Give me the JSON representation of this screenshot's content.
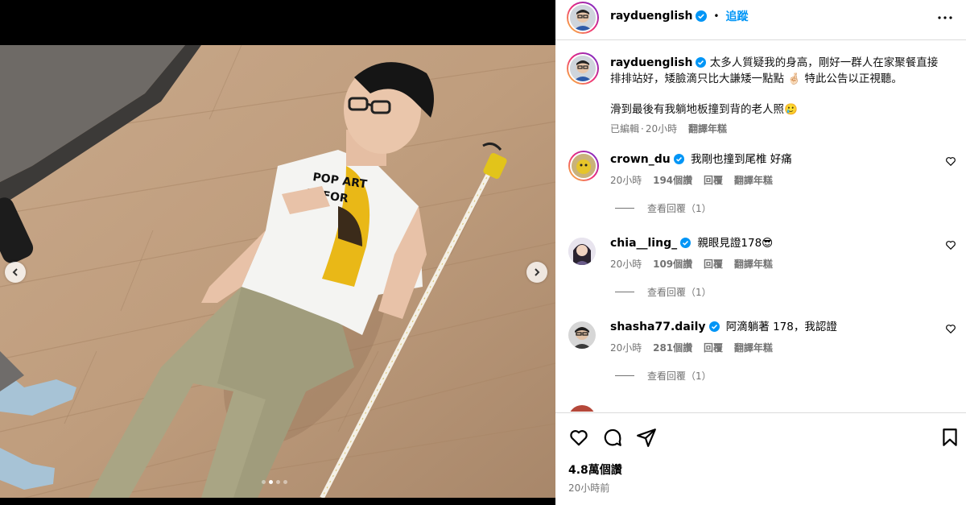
{
  "post": {
    "username": "rayduenglish",
    "follow_label": "追蹤",
    "separator": "•",
    "caption_line1": "太多人質疑我的身高，剛好一群人在家聚餐直接",
    "caption_line2": "排排站好，矮臉滴只比大謙矮一點點 🤞🏻 特此公告以正視聽。",
    "caption_line3": "滑到最後有我躺地板撞到背的老人照🥲",
    "edited_label": "已編輯",
    "caption_time": "20小時",
    "translate_label": "翻譯年糕",
    "likes": "4.8萬個讚",
    "post_time": "20小時前"
  },
  "comments": [
    {
      "username": "crown_du",
      "text": "我剛也撞到尾椎 好痛",
      "time": "20小時",
      "likes": "194個讚",
      "reply_label": "回覆",
      "translate_label": "翻譯年糕",
      "view_replies": "查看回覆（1）"
    },
    {
      "username": "chia__ling_",
      "text": "親眼見證178😎",
      "time": "20小時",
      "likes": "109個讚",
      "reply_label": "回覆",
      "translate_label": "翻譯年糕",
      "view_replies": "查看回覆（1）"
    },
    {
      "username": "shasha77.daily",
      "text": "阿滴躺著 178，我認證",
      "time": "20小時",
      "likes": "281個讚",
      "reply_label": "回覆",
      "translate_label": "翻譯年糕",
      "view_replies": "查看回覆（1）"
    }
  ],
  "carousel": {
    "slide_count": 4,
    "active_index": 1
  },
  "photo": {
    "shirt_text_line1": "POP ART",
    "shirt_text_line2": "IS FOR"
  },
  "icons": {
    "more": "more-horizontal-icon",
    "verified": "verified-badge-icon",
    "like": "heart-icon",
    "comment": "comment-bubble-icon",
    "share": "share-plane-icon",
    "save": "bookmark-icon",
    "prev": "chevron-left-icon",
    "next": "chevron-right-icon"
  },
  "colors": {
    "accent": "#0095f6",
    "verified": "#0095f6",
    "muted": "#737373",
    "border": "#dbdbdb"
  }
}
